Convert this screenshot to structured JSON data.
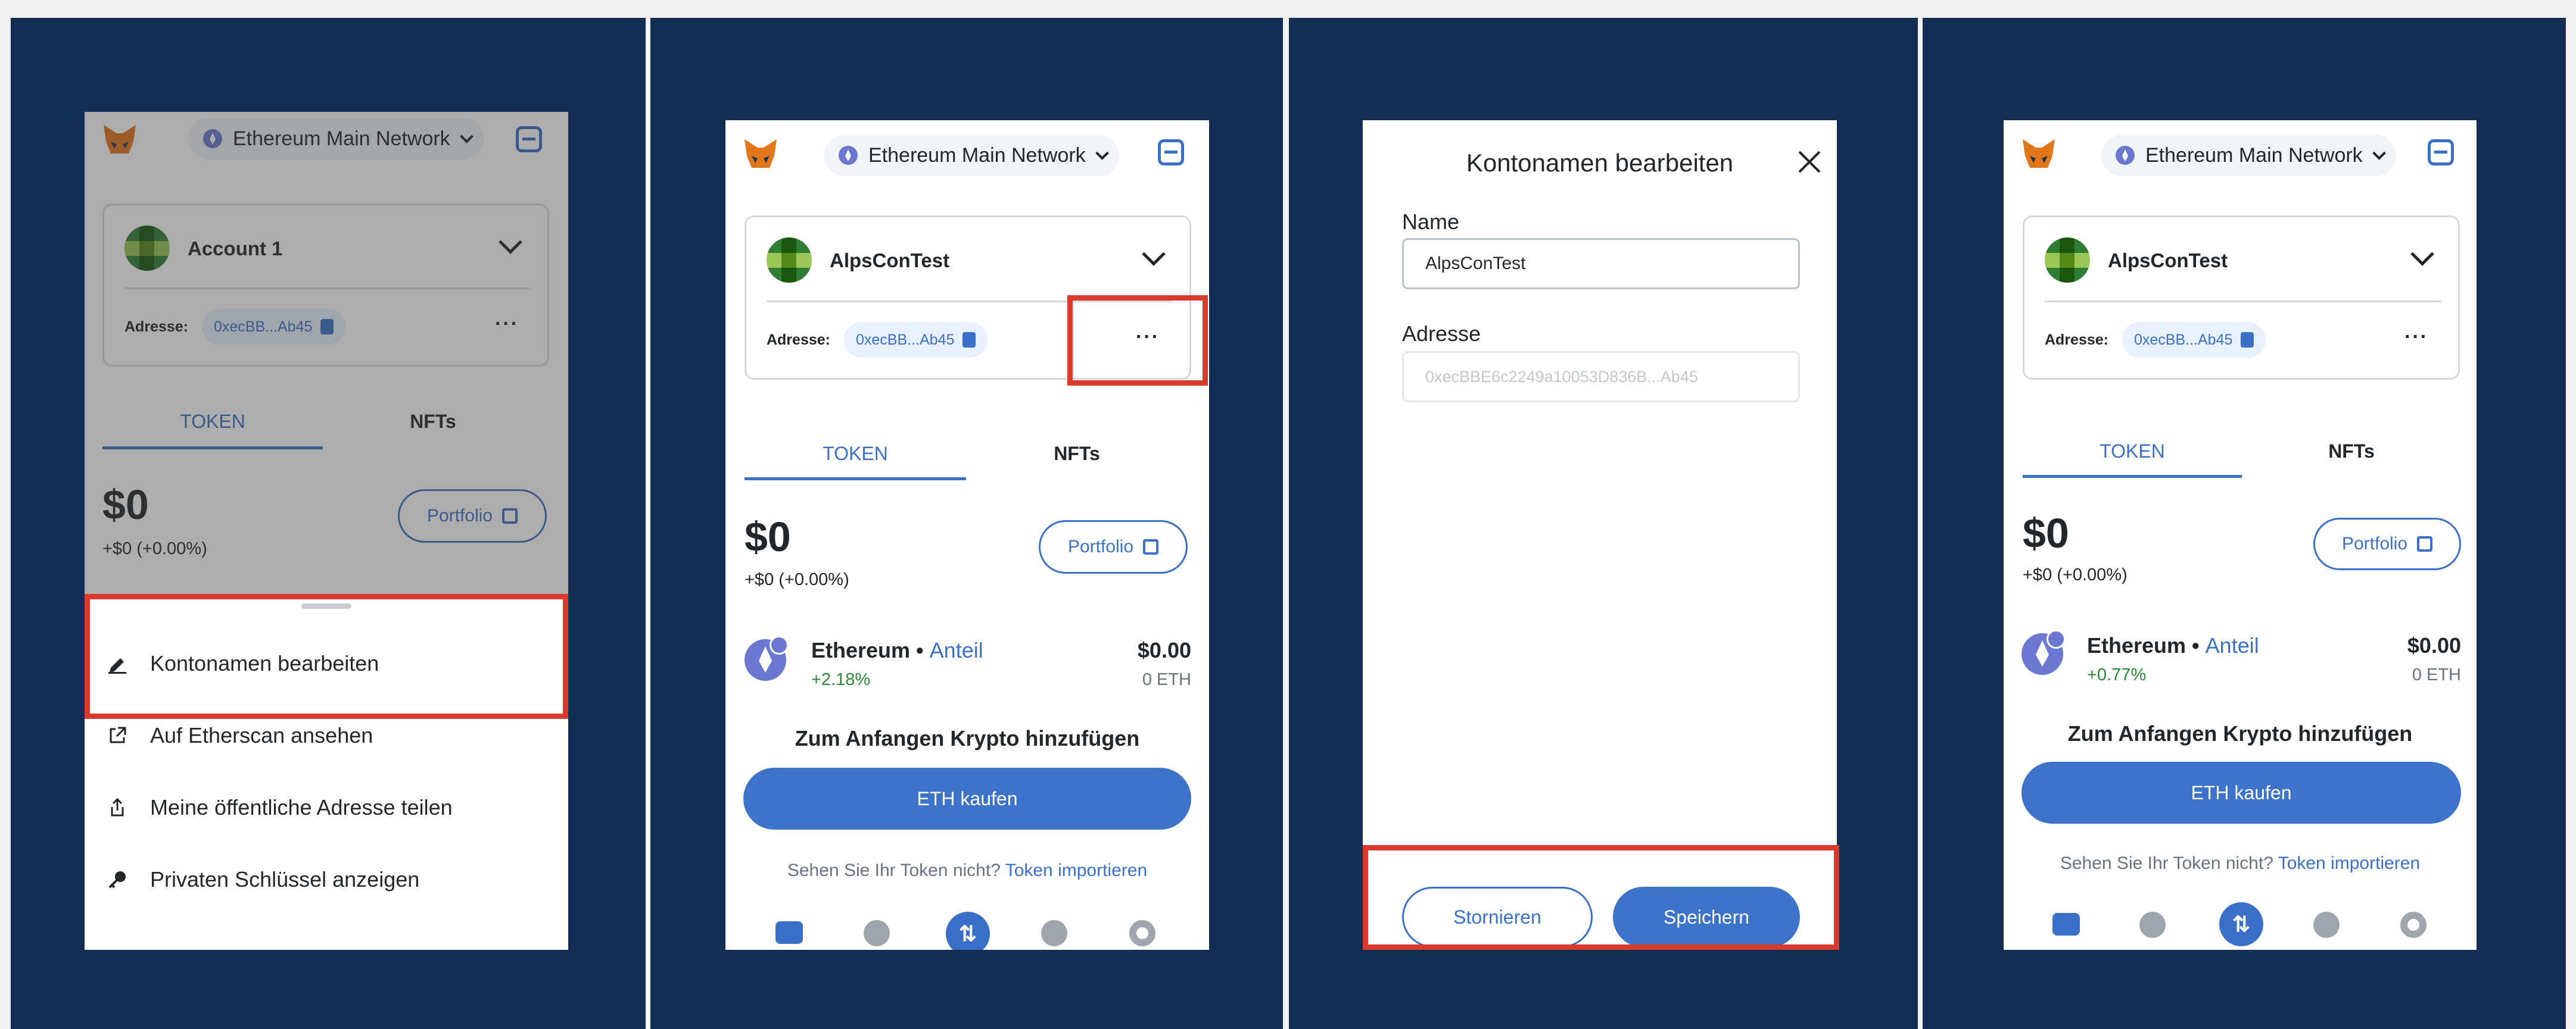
{
  "colors": {
    "background": "#132d54",
    "accent": "#3a70c7",
    "highlight": "#d93a2b",
    "positive": "#2a8a3a"
  },
  "icons": [
    "metamask-fox-icon",
    "ethereum-icon",
    "chevron-down-icon",
    "qr-scan-icon",
    "copy-icon",
    "more-dots-icon",
    "external-link-icon",
    "edit-pencil-icon",
    "share-icon",
    "key-icon",
    "close-icon",
    "wallet-icon",
    "clock-icon",
    "swap-icon",
    "compass-icon",
    "gear-icon"
  ],
  "network": {
    "label": "Ethereum Main Network"
  },
  "address": {
    "label": "Adresse:",
    "short": "0xecBB...Ab45",
    "more": "···"
  },
  "tabs": {
    "token": "TOKEN",
    "nfts": "NFTs"
  },
  "balance": {
    "amount": "$0",
    "delta": "+$0 (+0.00%)"
  },
  "portfolio": {
    "label": "Portfolio"
  },
  "token": {
    "name": "Ethereum",
    "sep": " • ",
    "share": "Anteil",
    "value": "$0.00",
    "eth": "0 ETH"
  },
  "cta": {
    "title": "Zum Anfangen Krypto hinzufügen",
    "buy": "ETH kaufen",
    "import_q": "Sehen Sie Ihr Token nicht?",
    "import_link": "Token importieren"
  },
  "screen1": {
    "account": "Account 1",
    "menu": [
      {
        "label": "Kontonamen bearbeiten",
        "icon": "edit-pencil-icon"
      },
      {
        "label": "Auf Etherscan ansehen",
        "icon": "external-link-icon"
      },
      {
        "label": "Meine öffentliche Adresse teilen",
        "icon": "share-icon"
      },
      {
        "label": "Privaten Schlüssel anzeigen",
        "icon": "key-icon"
      }
    ]
  },
  "screen2": {
    "account": "AlpsConTest",
    "pct": "+2.18%"
  },
  "screen3": {
    "title": "Kontonamen bearbeiten",
    "name_label": "Name",
    "name_value": "AlpsConTest",
    "addr_label": "Adresse",
    "addr_value": "0xecBBE6c2249a10053D836B...Ab45",
    "cancel": "Stornieren",
    "save": "Speichern"
  },
  "screen4": {
    "account": "AlpsConTest",
    "pct": "+0.77%"
  }
}
